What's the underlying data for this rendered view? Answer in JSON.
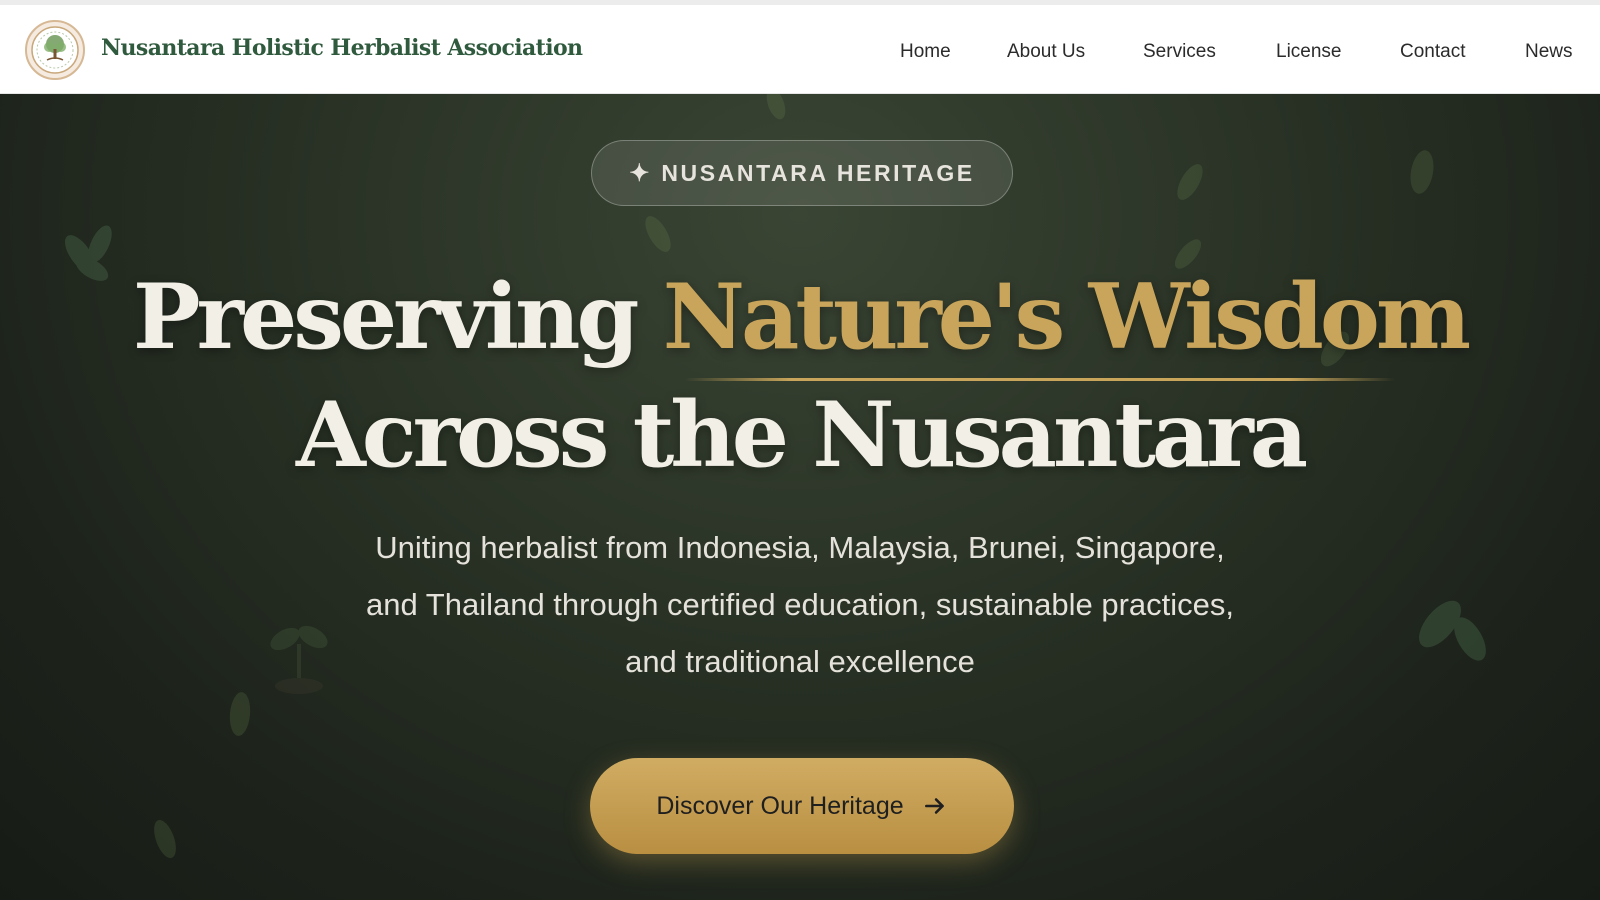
{
  "header": {
    "brand": "Nusantara Holistic Herbalist Association",
    "nav": [
      {
        "label": "Home"
      },
      {
        "label": "About Us"
      },
      {
        "label": "Services"
      },
      {
        "label": "License"
      },
      {
        "label": "Contact"
      },
      {
        "label": "News"
      }
    ]
  },
  "hero": {
    "badge": {
      "icon": "sparkle-icon",
      "label": "NUSANTARA HERITAGE"
    },
    "headline": {
      "part1": "Preserving ",
      "highlight": "Nature's Wisdom",
      "line2": "Across the Nusantara"
    },
    "subtitle_lines": [
      "Uniting herbalist from Indonesia, Malaysia, Brunei, Singapore,",
      "and Thailand through certified education, sustainable practices,",
      "and traditional excellence"
    ],
    "cta": {
      "label": "Discover Our Heritage",
      "icon": "arrow-right-icon"
    }
  },
  "colors": {
    "brand_green": "#2f5a3d",
    "accent_gold": "#c9a55b",
    "hero_dark": "#1d231b"
  }
}
